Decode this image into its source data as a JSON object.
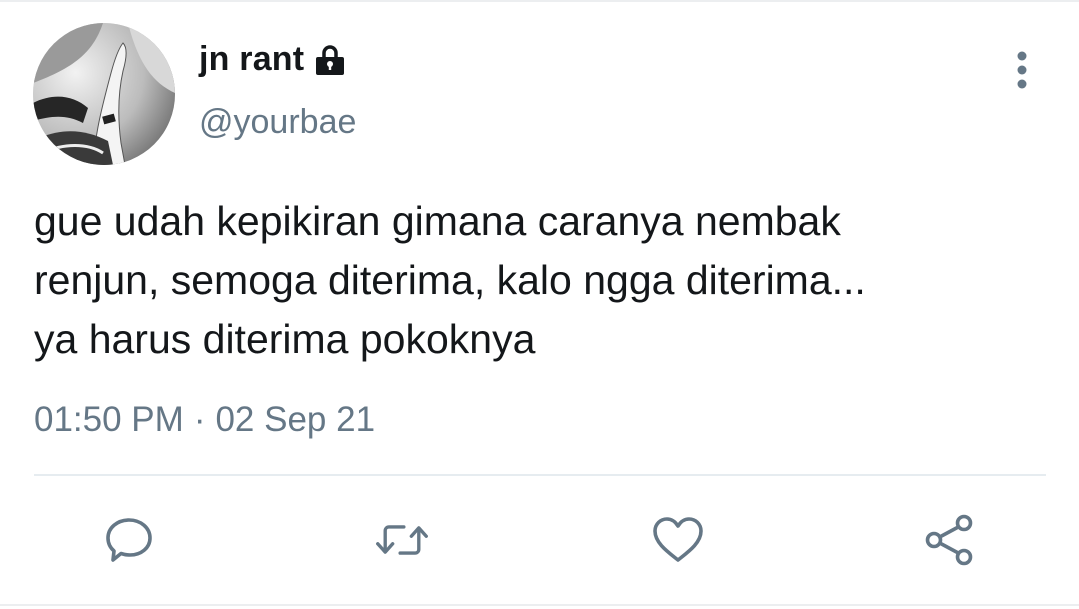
{
  "tweet": {
    "author": {
      "display_name": "jn rant",
      "handle": "@yourbae",
      "protected_icon": "lock-icon",
      "avatar": "profile-photo"
    },
    "text": "gue udah kepikiran gimana caranya nembak\nrenjun, semoga diterima, kalo ngga diterima...\nya harus diterima pokoknya",
    "time": "01:50 PM",
    "separator": "·",
    "date": "02 Sep 21",
    "menu_icon": "more-vertical-icon",
    "actions": {
      "reply_icon": "reply-icon",
      "retweet_icon": "retweet-icon",
      "like_icon": "heart-icon",
      "share_icon": "share-icon"
    }
  },
  "colors": {
    "text_primary": "#14171a",
    "text_secondary": "#657786",
    "action_icon": "#657786",
    "divider": "#e6ecf0"
  }
}
